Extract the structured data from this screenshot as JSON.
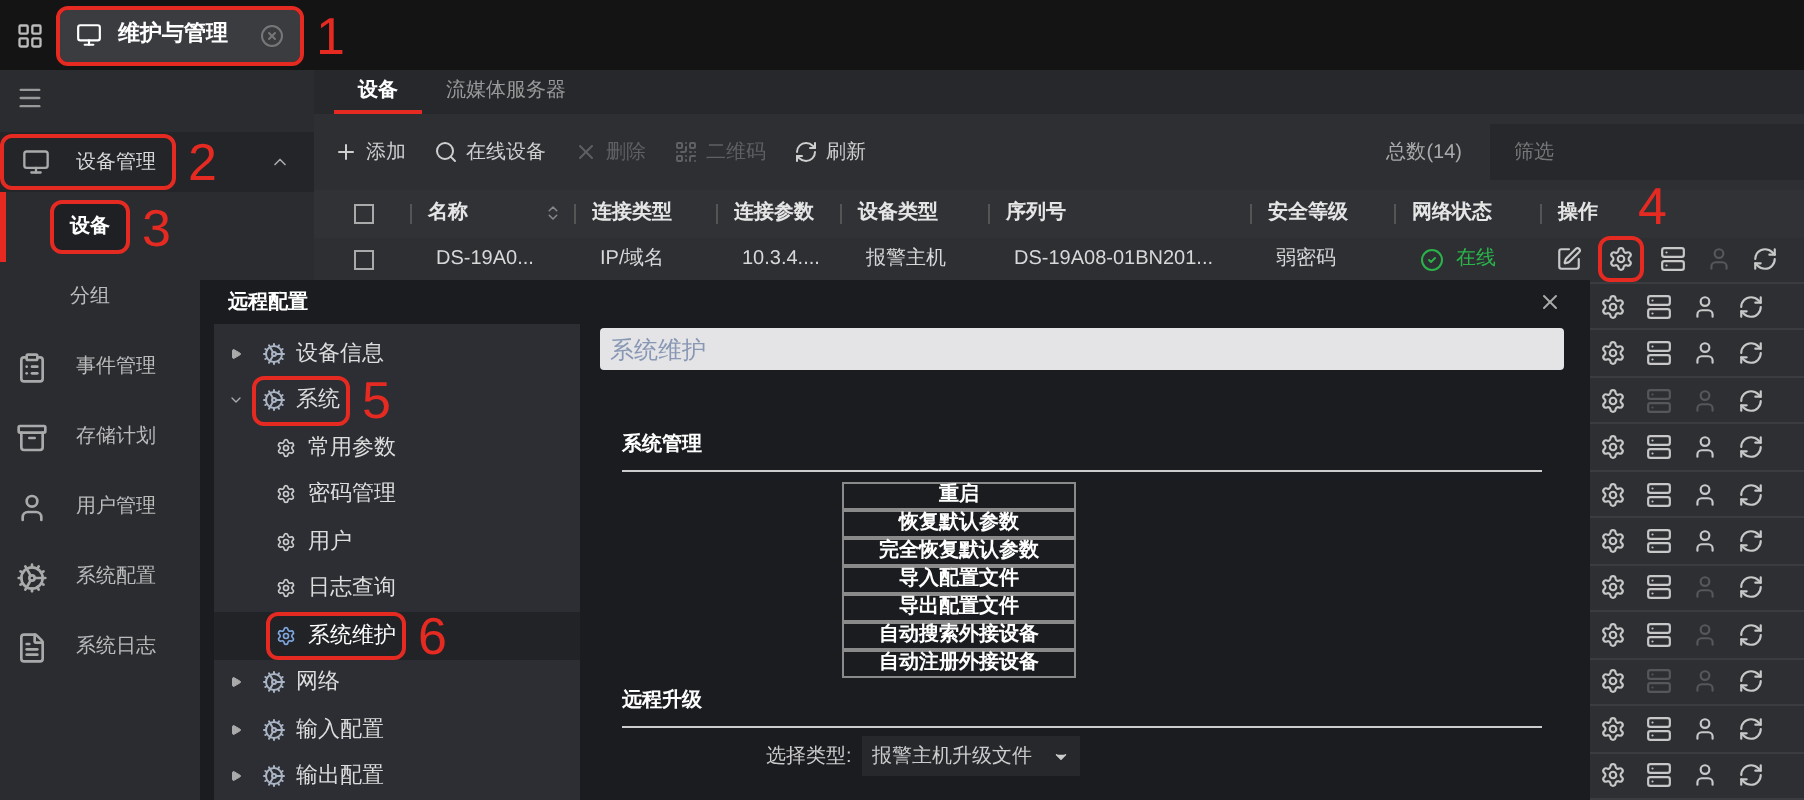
{
  "top_bar": {
    "tab": {
      "label": "维护与管理",
      "selected": true,
      "annotation": "1"
    }
  },
  "sidebar": {
    "group": {
      "label": "设备管理",
      "expanded": true,
      "annotation": "2"
    },
    "sub_items": [
      {
        "label": "设备",
        "selected": true,
        "annotation": "3"
      },
      {
        "label": "分组",
        "selected": false
      }
    ],
    "items": [
      {
        "kind": "event",
        "label": "事件管理"
      },
      {
        "kind": "storage",
        "label": "存储计划"
      },
      {
        "kind": "user",
        "label": "用户管理"
      },
      {
        "kind": "config",
        "label": "系统配置"
      },
      {
        "kind": "log",
        "label": "系统日志"
      }
    ]
  },
  "tabs": [
    {
      "label": "设备",
      "selected": true
    },
    {
      "label": "流媒体服务器",
      "selected": false
    }
  ],
  "toolbar": {
    "buttons": [
      {
        "kind": "add",
        "label": "添加",
        "disabled": false
      },
      {
        "kind": "search",
        "label": "在线设备",
        "disabled": false
      },
      {
        "kind": "delete",
        "label": "删除",
        "disabled": true
      },
      {
        "kind": "qr",
        "label": "二维码",
        "disabled": true
      },
      {
        "kind": "refresh",
        "label": "刷新",
        "disabled": false
      }
    ],
    "total": "总数(14)",
    "filter": {
      "placeholder": "筛选"
    }
  },
  "table": {
    "header_checked": false,
    "columns": [
      "名称",
      "连接类型",
      "连接参数",
      "设备类型",
      "序列号",
      "安全等级",
      "网络状态",
      "操作"
    ],
    "rows": [
      {
        "checked": false,
        "cells": [
          "DS-19A0...",
          "IP/域名",
          "10.3.4....",
          "报警主机",
          "DS-19A08-01BN201...",
          "弱密码"
        ],
        "online": true,
        "status": "在线",
        "actions": [
          {
            "kind": "edit",
            "disabled": false
          },
          {
            "kind": "gear",
            "disabled": false,
            "annotation": "4"
          },
          {
            "kind": "server",
            "disabled": false
          },
          {
            "kind": "user",
            "disabled": true
          },
          {
            "kind": "refresh",
            "disabled": false
          }
        ]
      },
      {
        "actions": [
          {
            "kind": "gear",
            "disabled": false
          },
          {
            "kind": "server",
            "disabled": false
          },
          {
            "kind": "user",
            "disabled": false
          },
          {
            "kind": "refresh",
            "disabled": false
          }
        ]
      },
      {
        "actions": [
          {
            "kind": "gear",
            "disabled": false
          },
          {
            "kind": "server",
            "disabled": false
          },
          {
            "kind": "user",
            "disabled": false
          },
          {
            "kind": "refresh",
            "disabled": false
          }
        ]
      },
      {
        "actions": [
          {
            "kind": "gear",
            "disabled": false
          },
          {
            "kind": "server",
            "disabled": true
          },
          {
            "kind": "user",
            "disabled": true
          },
          {
            "kind": "refresh",
            "disabled": false
          }
        ]
      },
      {
        "actions": [
          {
            "kind": "gear",
            "disabled": false
          },
          {
            "kind": "server",
            "disabled": false
          },
          {
            "kind": "user",
            "disabled": false
          },
          {
            "kind": "refresh",
            "disabled": false
          }
        ]
      },
      {
        "actions": [
          {
            "kind": "gear",
            "disabled": false
          },
          {
            "kind": "server",
            "disabled": false
          },
          {
            "kind": "user",
            "disabled": false
          },
          {
            "kind": "refresh",
            "disabled": false
          }
        ]
      },
      {
        "actions": [
          {
            "kind": "gear",
            "disabled": false
          },
          {
            "kind": "server",
            "disabled": false
          },
          {
            "kind": "user",
            "disabled": false
          },
          {
            "kind": "refresh",
            "disabled": false
          }
        ]
      },
      {
        "actions": [
          {
            "kind": "gear",
            "disabled": false
          },
          {
            "kind": "server",
            "disabled": false
          },
          {
            "kind": "user",
            "disabled": true
          },
          {
            "kind": "refresh",
            "disabled": false
          }
        ]
      },
      {
        "actions": [
          {
            "kind": "gear",
            "disabled": false
          },
          {
            "kind": "server",
            "disabled": false
          },
          {
            "kind": "user",
            "disabled": true
          },
          {
            "kind": "refresh",
            "disabled": false
          }
        ]
      },
      {
        "actions": [
          {
            "kind": "gear",
            "disabled": false
          },
          {
            "kind": "server",
            "disabled": true
          },
          {
            "kind": "user",
            "disabled": true
          },
          {
            "kind": "refresh",
            "disabled": false
          }
        ]
      },
      {
        "actions": [
          {
            "kind": "gear",
            "disabled": false
          },
          {
            "kind": "server",
            "disabled": false
          },
          {
            "kind": "user",
            "disabled": false
          },
          {
            "kind": "refresh",
            "disabled": false
          }
        ]
      },
      {
        "actions": [
          {
            "kind": "gear",
            "disabled": false
          },
          {
            "kind": "server",
            "disabled": false
          },
          {
            "kind": "user",
            "disabled": false
          },
          {
            "kind": "refresh",
            "disabled": false
          }
        ]
      }
    ]
  },
  "dialog": {
    "title": "远程配置",
    "tree": [
      {
        "label": "设备信息",
        "expanded": false,
        "selected": false
      },
      {
        "label": "系统",
        "expanded": true,
        "selected": false,
        "annotation": "5",
        "children": [
          {
            "label": "常用参数",
            "selected": false
          },
          {
            "label": "密码管理",
            "selected": false
          },
          {
            "label": "用户",
            "selected": false
          },
          {
            "label": "日志查询",
            "selected": false
          },
          {
            "label": "系统维护",
            "selected": true,
            "annotation": "6"
          }
        ]
      },
      {
        "label": "网络",
        "expanded": false,
        "selected": false
      },
      {
        "label": "输入配置",
        "expanded": false,
        "selected": false
      },
      {
        "label": "输出配置",
        "expanded": false,
        "selected": false
      }
    ],
    "panel_title": "系统维护",
    "sections": [
      {
        "title": "系统管理",
        "buttons": [
          "重启",
          "恢复默认参数",
          "完全恢复默认参数",
          "导入配置文件",
          "导出配置文件",
          "自动搜索外接设备",
          "自动注册外接设备"
        ]
      },
      {
        "title": "远程升级",
        "field": {
          "label": "选择类型:",
          "value": "报警主机升级文件"
        }
      }
    ]
  }
}
